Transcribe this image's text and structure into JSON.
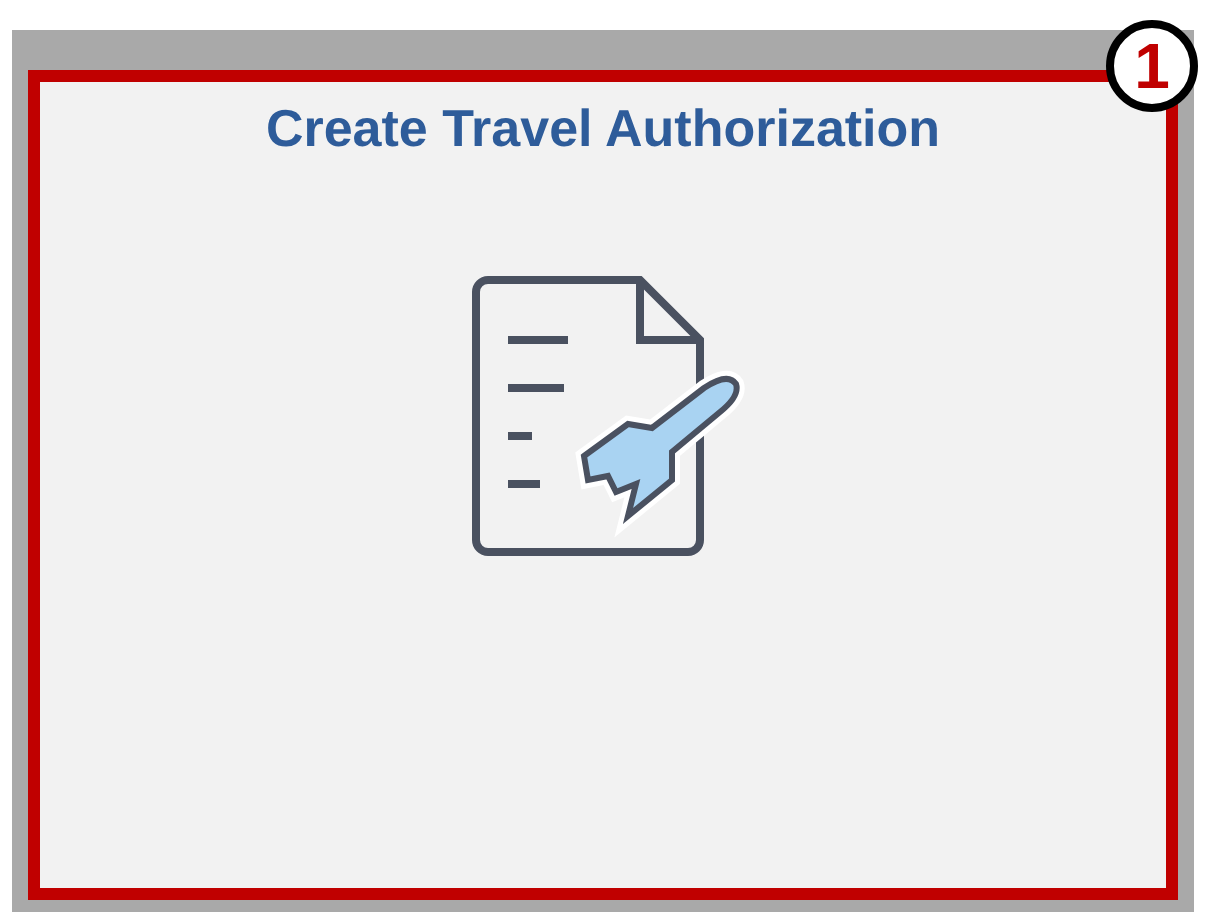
{
  "tile": {
    "title": "Create Travel Authorization"
  },
  "callout": {
    "number": "1"
  }
}
